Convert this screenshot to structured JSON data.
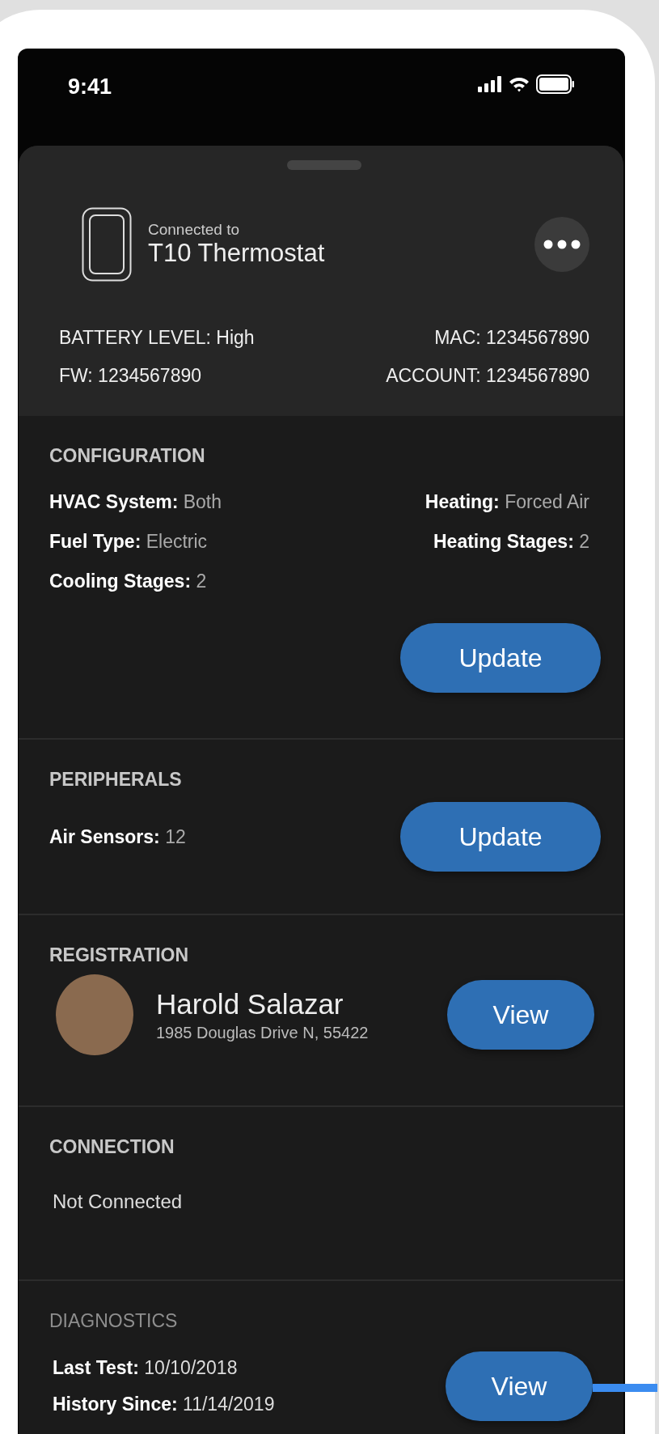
{
  "status_bar": {
    "time": "9:41"
  },
  "device": {
    "caption": "Connected to",
    "name": "T10 Thermostat"
  },
  "device_info": [
    "BATTERY LEVEL: High",
    "MAC: 1234567890",
    "FW: 1234567890",
    "ACCOUNT: 1234567890"
  ],
  "sections": [
    {
      "kind": "config",
      "title": "CONFIGURATION",
      "muted": false,
      "items": [
        "**HVAC System:** Both",
        "**Heating:** Forced Air",
        "**Fuel Type:** Electric",
        "**Heating Stages:** 2",
        "**Cooling Stages:** 2"
      ],
      "button": "Update"
    },
    {
      "kind": "peripherals",
      "title": "PERIPHERALS",
      "muted": false,
      "items": [
        "**Air Sensors:** 12"
      ],
      "button": "Update"
    },
    {
      "kind": "registration",
      "title": "REGISTRATION",
      "muted": false,
      "name": "Harold Salazar",
      "address": "1985 Douglas Drive N, 55422",
      "button": "View"
    },
    {
      "kind": "connection",
      "title": "CONNECTION",
      "muted": false,
      "text": "Not Connected"
    },
    {
      "kind": "diagnostics",
      "title": "DIAGNOSTICS",
      "muted": true,
      "items": [
        "**Last Test:** 10/10/2018",
        "**History Since:** 11/14/2019"
      ],
      "button": "View"
    }
  ]
}
